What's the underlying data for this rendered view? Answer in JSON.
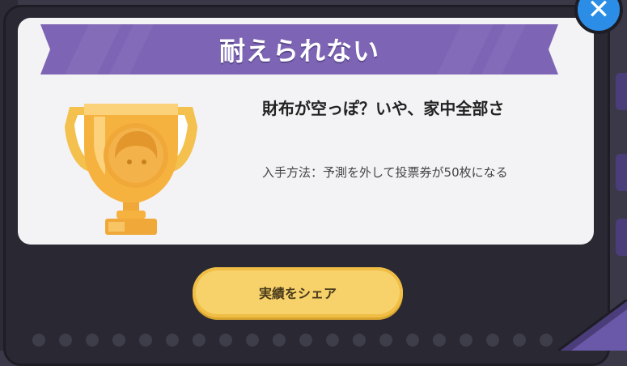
{
  "achievement": {
    "name": "耐えられない",
    "title": "財布が空っぽ？いや、家中全部さ",
    "description": "入手方法：予測を外して投票券が50枚になる"
  },
  "share_button": {
    "label": "実績をシェア"
  },
  "close_button": {
    "icon": "close-icon",
    "glyph": "✕"
  },
  "colors": {
    "ribbon": "#7e64b4",
    "share_button": "#f7d26a",
    "close_button": "#2b8de6",
    "trophy": "#f0b042"
  }
}
